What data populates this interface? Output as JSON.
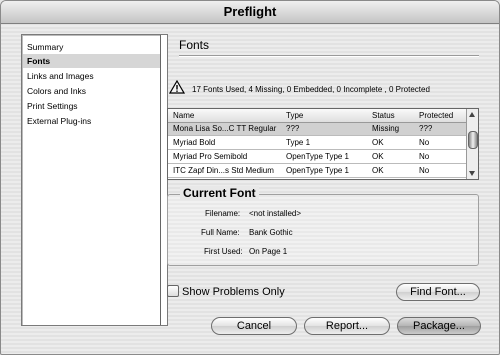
{
  "window": {
    "title": "Preflight"
  },
  "sidebar": {
    "items": [
      {
        "label": "Summary"
      },
      {
        "label": "Fonts",
        "selected": true
      },
      {
        "label": "Links and Images"
      },
      {
        "label": "Colors and Inks"
      },
      {
        "label": "Print Settings"
      },
      {
        "label": "External Plug-ins"
      }
    ]
  },
  "panel": {
    "heading": "Fonts",
    "warning_icon": "warning-triangle-icon",
    "summary": "17 Fonts Used, 4 Missing, 0 Embedded, 0 Incomplete , 0 Protected"
  },
  "fonts_table": {
    "headers": [
      "Name",
      "Type",
      "Status",
      "Protected"
    ],
    "rows": [
      {
        "name": "Mona Lisa So...C TT Regular",
        "type": "???",
        "status": "Missing",
        "protected": "???"
      },
      {
        "name": "Myriad Bold",
        "type": "Type 1",
        "status": "OK",
        "protected": "No"
      },
      {
        "name": "Myriad Pro Semibold",
        "type": "OpenType Type 1",
        "status": "OK",
        "protected": "No"
      },
      {
        "name": "ITC Zapf Din...s Std Medium",
        "type": "OpenType Type 1",
        "status": "OK",
        "protected": "No"
      }
    ]
  },
  "current_font": {
    "title": "Current Font",
    "filename_label": "Filename:",
    "filename": "<not installed>",
    "fullname_label": "Full Name:",
    "fullname": "Bank Gothic",
    "firstused_label": "First Used:",
    "firstused": "On Page 1"
  },
  "show_problems": {
    "label": "Show Problems Only",
    "checked": false
  },
  "buttons": {
    "find_font": "Find Font...",
    "cancel": "Cancel",
    "report": "Report...",
    "package": "Package..."
  }
}
